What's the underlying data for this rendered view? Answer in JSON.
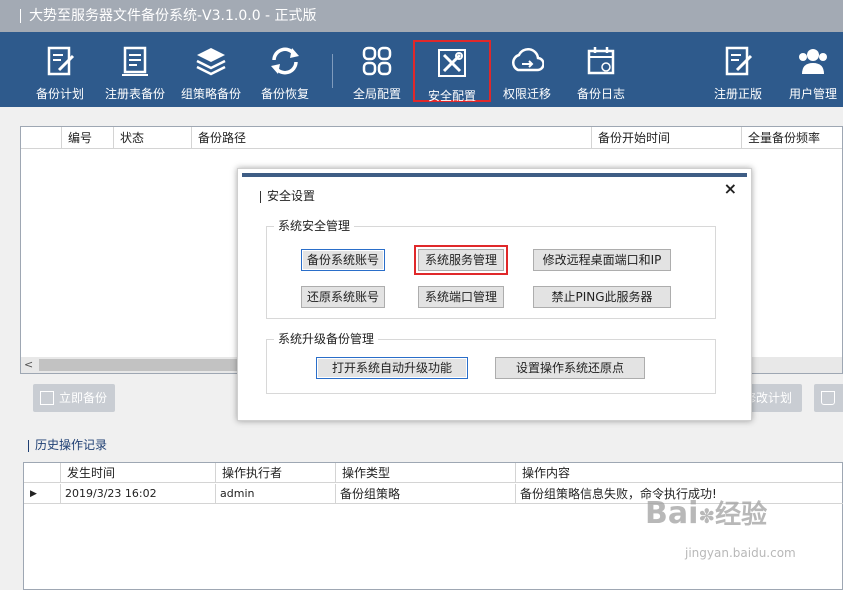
{
  "window": {
    "title": "大势至服务器文件备份系统-V3.1.0.0 - 正式版"
  },
  "toolbar": {
    "items": [
      {
        "label": "备份计划",
        "icon": "edit-note-icon"
      },
      {
        "label": "注册表备份",
        "icon": "document-list-icon"
      },
      {
        "label": "组策略备份",
        "icon": "layers-icon"
      },
      {
        "label": "备份恢复",
        "icon": "refresh-icon"
      },
      {
        "label": "全局配置",
        "icon": "grid-icon"
      },
      {
        "label": "安全配置",
        "icon": "tools-icon"
      },
      {
        "label": "权限迁移",
        "icon": "cloud-transfer-icon"
      },
      {
        "label": "备份日志",
        "icon": "calendar-icon"
      },
      {
        "label": "注册正版",
        "icon": "register-icon"
      },
      {
        "label": "用户管理",
        "icon": "users-icon"
      }
    ],
    "active": "安全配置"
  },
  "plan_table": {
    "columns": [
      "编号",
      "状态",
      "备份路径",
      "备份开始时间",
      "全量备份频率"
    ]
  },
  "actions": {
    "backup_now": "立即备份",
    "modify_plan": "修改计划"
  },
  "history": {
    "label": "历史操作记录",
    "columns": [
      "发生时间",
      "操作执行者",
      "操作类型",
      "操作内容"
    ],
    "rows": [
      {
        "time": "2019/3/23 16:02",
        "user": "admin",
        "type": "备份组策略",
        "content": "备份组策略信息失败，命令执行成功!"
      }
    ]
  },
  "dialog": {
    "title": "安全设置",
    "close": "×",
    "group1": {
      "label": "系统安全管理",
      "buttons": [
        "备份系统账号",
        "系统服务管理",
        "修改远程桌面端口和IP",
        "还原系统账号",
        "系统端口管理",
        "禁止PING此服务器"
      ]
    },
    "group2": {
      "label": "系统升级备份管理",
      "buttons": [
        "打开系统自动升级功能",
        "设置操作系统还原点"
      ]
    }
  },
  "watermark": {
    "brand": "Bai",
    "brand2": "经验",
    "url": "jingyan.baidu.com"
  },
  "colors": {
    "toolbar": "#2e5a8c",
    "titlebar": "#a3aab4",
    "highlight": "#e0282a"
  }
}
